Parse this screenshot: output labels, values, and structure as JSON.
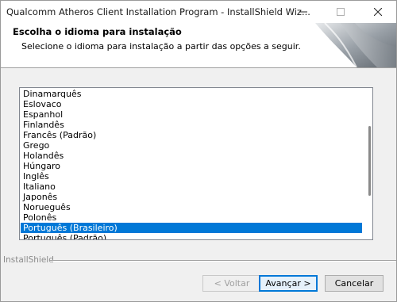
{
  "window": {
    "title": "Qualcomm Atheros Client Installation Program - InstallShield Wiz..."
  },
  "header": {
    "title": "Escolha o idioma para instalação",
    "subtitle": "Selecione o idioma para instalação a partir das opções a seguir."
  },
  "languages": {
    "items": [
      "Dinamarquês",
      "Eslovaco",
      "Espanhol",
      "Finlandês",
      "Francês (Padrão)",
      "Grego",
      "Holandês",
      "Húngaro",
      "Inglês",
      "Italiano",
      "Japonês",
      "Norueguês",
      "Polonês",
      "Português (Brasileiro)",
      "Português (Padrão)"
    ],
    "selected": "Português (Brasileiro)"
  },
  "footer": {
    "brand": "InstallShield"
  },
  "buttons": {
    "back": "< Voltar",
    "next": "Avançar >",
    "cancel": "Cancelar"
  },
  "colors": {
    "selection": "#0078d7",
    "accent": "#0078d7"
  }
}
